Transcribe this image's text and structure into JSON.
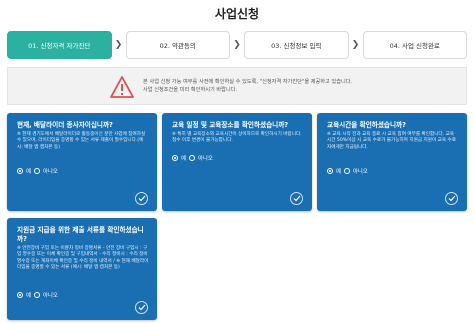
{
  "header": {
    "title": "사업신청"
  },
  "steps": [
    {
      "label": "01. 신청자격 자가진단"
    },
    {
      "label": "02. 약관동의"
    },
    {
      "label": "03. 신청정보 입력"
    },
    {
      "label": "04. 사업 신청완료"
    }
  ],
  "notice": {
    "line1": "본 사업 신청 가능 여부를 사전에 확인하실 수 있도록, \"신청자격 자가진단\"을 제공하고 있습니다.",
    "line2": "사업 신청조건을 미리 확인하시기 바랍니다."
  },
  "cards": [
    {
      "question": "현재, 배달라이더 종사자이십니까?",
      "description": "※ 현재 경기도에서 배달라이더로 활동중이신 분만 사업에 참여하실 수 있으며, 라이더임을 증명할 수 있는 서류 제출이 필수입니다.(예시: 배달 앱 캡처본 등)",
      "option_yes": "예",
      "option_no": "아니오"
    },
    {
      "question": "교육 일정 및 교육장소를 확인하셨습니까?",
      "description": "※ 특히 별 교육장소와 교육시간이 상이하므로 확인하시기 바랍니다. 접수 이후 변경이 불가능합니다.",
      "option_yes": "예",
      "option_no": "아니오"
    },
    {
      "question": "교육시간을 확인하셨습니까?",
      "description": "※ 교육 시작 전과 교육 종료 시 교육 참여 여부를 확인합니다. 교육 시간 50%이상 시 교육 수료가 불가능하며 지원금 지원이 교육 수료자에게만 지급됩니다.",
      "option_yes": "예",
      "option_no": "아니오"
    },
    {
      "question": "지원금 지급을 위한 제출 서류를 확인하셨습니까?",
      "description": "※ 안전장비 구입 또는 이륜차 정비 증명서류 - 안전 장비 구입시 : 구입 영수증 또는 이체 확인증 및 구입내역서 - 수리 정비시 : 수리 정비 영수증 또는 계좌이체 확인증 및 수리 정비 내역서 / ※ 현재 배달라이더임을 증명할 수 있는 서류 (예시: 배달 앱 캡처본 등)",
      "option_yes": "예",
      "option_no": "아니오"
    }
  ],
  "colors": {
    "accent": "#2bb1a0",
    "card": "#1a6fb3",
    "warning": "#d9534f"
  }
}
